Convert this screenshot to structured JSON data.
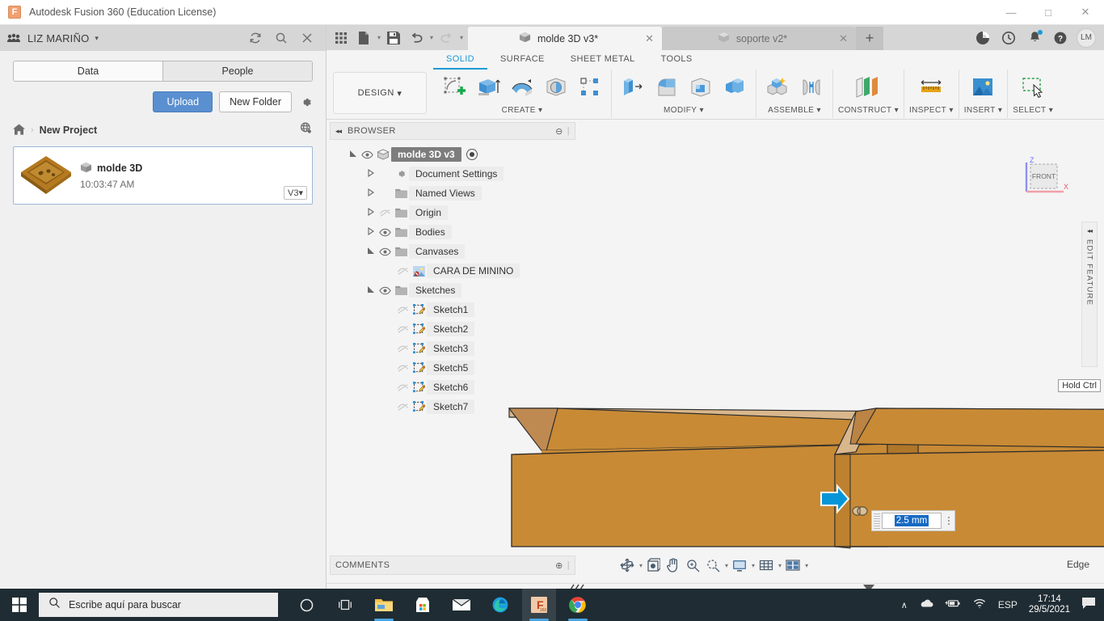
{
  "window": {
    "title": "Autodesk Fusion 360 (Education License)",
    "logo_letter": "F",
    "minimize": "—",
    "maximize": "□",
    "close": "✕"
  },
  "data_panel": {
    "hub_name": "LIZ MARIÑO",
    "hub_caret": "▾",
    "header_icons": [
      "grid-icon",
      "refresh-icon",
      "search-icon",
      "close-icon"
    ],
    "tabs": [
      {
        "label": "Data",
        "active": true
      },
      {
        "label": "People",
        "active": false
      }
    ],
    "upload_label": "Upload",
    "new_folder_label": "New Folder",
    "breadcrumb": {
      "home": "⌂",
      "separator": "›",
      "project": "New Project"
    },
    "file": {
      "name": "molde 3D",
      "time": "10:03:47 AM",
      "version": "V3",
      "version_caret": "▾"
    }
  },
  "quick_access": {
    "icons": [
      "apps-grid-icon",
      "new-file-icon",
      "save-icon",
      "undo-icon",
      "redo-icon"
    ]
  },
  "doc_tabs": [
    {
      "label": "molde 3D v3*",
      "active": true,
      "close": "✕"
    },
    {
      "label": "soporte v2*",
      "active": false,
      "close": "✕"
    }
  ],
  "tab_plus": "+",
  "top_right_icons": [
    "job-status-icon",
    "recent-icon",
    "notifications-icon",
    "help-icon"
  ],
  "avatar_initials": "LM",
  "ribbon": {
    "design_label": "DESIGN",
    "design_caret": "▾",
    "tabs": [
      {
        "label": "SOLID",
        "active": true
      },
      {
        "label": "SURFACE",
        "active": false
      },
      {
        "label": "SHEET METAL",
        "active": false
      },
      {
        "label": "TOOLS",
        "active": false
      }
    ],
    "groups": [
      {
        "label": "CREATE",
        "caret": "▾",
        "icons": [
          "create-sketch-icon",
          "extrude-icon",
          "revolve-icon",
          "sphere-icon",
          "pattern-icon"
        ]
      },
      {
        "label": "MODIFY",
        "caret": "▾",
        "icons": [
          "press-pull-icon",
          "fillet-icon",
          "shell-icon",
          "combine-icon"
        ]
      },
      {
        "label": "ASSEMBLE",
        "caret": "▾",
        "icons": [
          "new-component-icon",
          "joint-icon"
        ]
      },
      {
        "label": "CONSTRUCT",
        "caret": "▾",
        "icons": [
          "offset-plane-icon"
        ]
      },
      {
        "label": "INSPECT",
        "caret": "▾",
        "icons": [
          "measure-icon"
        ]
      },
      {
        "label": "INSERT",
        "caret": "▾",
        "icons": [
          "insert-canvas-icon"
        ]
      },
      {
        "label": "SELECT",
        "caret": "▾",
        "icons": [
          "select-window-icon"
        ]
      }
    ]
  },
  "browser": {
    "title": "BROWSER",
    "collapse": "◂◂",
    "minus": "⊖",
    "tree": [
      {
        "label": "molde 3D v3",
        "indent": 0,
        "arrow": "open",
        "eye": "on",
        "icon": "component-icon",
        "root": true
      },
      {
        "label": "Document Settings",
        "indent": 1,
        "arrow": "closed",
        "eye": "none",
        "icon": "gear-icon"
      },
      {
        "label": "Named Views",
        "indent": 1,
        "arrow": "closed",
        "eye": "none",
        "icon": "folder-icon"
      },
      {
        "label": "Origin",
        "indent": 1,
        "arrow": "closed",
        "eye": "off",
        "icon": "folder-icon"
      },
      {
        "label": "Bodies",
        "indent": 1,
        "arrow": "closed",
        "eye": "on",
        "icon": "folder-icon"
      },
      {
        "label": "Canvases",
        "indent": 1,
        "arrow": "open",
        "eye": "on",
        "icon": "folder-icon"
      },
      {
        "label": "CARA DE MININO",
        "indent": 2,
        "arrow": "none",
        "eye": "off",
        "icon": "canvas-icon"
      },
      {
        "label": "Sketches",
        "indent": 1,
        "arrow": "open",
        "eye": "on",
        "icon": "folder-icon"
      },
      {
        "label": "Sketch1",
        "indent": 2,
        "arrow": "none",
        "eye": "off",
        "icon": "sketch-icon"
      },
      {
        "label": "Sketch2",
        "indent": 2,
        "arrow": "none",
        "eye": "off",
        "icon": "sketch-icon"
      },
      {
        "label": "Sketch3",
        "indent": 2,
        "arrow": "none",
        "eye": "off",
        "icon": "sketch-icon"
      },
      {
        "label": "Sketch5",
        "indent": 2,
        "arrow": "none",
        "eye": "off",
        "icon": "sketch-icon"
      },
      {
        "label": "Sketch6",
        "indent": 2,
        "arrow": "none",
        "eye": "off",
        "icon": "sketch-icon"
      },
      {
        "label": "Sketch7",
        "indent": 2,
        "arrow": "none",
        "eye": "off",
        "icon": "sketch-icon"
      }
    ]
  },
  "viewport": {
    "viewcube_face": "FRONT",
    "axis_z": "Z",
    "axis_x": "X",
    "edit_feature_label": "EDIT FEATURE",
    "edit_feature_collapse": "◂◂",
    "hold_ctrl_tooltip": "Hold Ctrl",
    "dimension_value": "2.5 mm",
    "model_color": "#c88a35",
    "model_color_light": "#d9b78c",
    "model_color_dark": "#b0762a",
    "manipulator_arrow_color": "#0696d7",
    "selection_highlight": "#1669c4"
  },
  "comments": {
    "title": "COMMENTS",
    "add": "⊕"
  },
  "nav_toolbar": {
    "icons": [
      "orbit-icon",
      "view-front-icon",
      "pan-icon",
      "zoom-icon",
      "fit-icon",
      "display-settings-icon",
      "grid-snaps-icon",
      "viewports-icon"
    ]
  },
  "status": {
    "selection_filter": "Edge"
  },
  "timeline": {
    "playback": [
      "skip-start-icon",
      "step-back-icon",
      "play-icon",
      "step-forward-icon",
      "skip-end-icon"
    ],
    "nodes": [
      "sketch-icon",
      "extrude-icon",
      "sketch-icon",
      "canvas-icon",
      "extrude-icon",
      "sketch-icon",
      "extrude-icon",
      "sketch-icon",
      "extrude-icon",
      "sketch-icon",
      "extrude-icon",
      "sketch-icon",
      "extrude-icon",
      "fillet-icon",
      "fillet-icon",
      "fillet-icon",
      "fillet-icon",
      "fillet-icon",
      "fillet-icon",
      "fillet-icon",
      "fillet-icon"
    ],
    "settings": "gear-icon"
  },
  "taskbar": {
    "start": "windows-icon",
    "search_placeholder": "Escribe aquí para buscar",
    "apps": [
      {
        "name": "cortana-icon",
        "active": false,
        "running": false
      },
      {
        "name": "task-view-icon",
        "active": false,
        "running": false
      },
      {
        "name": "file-explorer-icon",
        "active": false,
        "running": true
      },
      {
        "name": "microsoft-store-icon",
        "active": false,
        "running": false
      },
      {
        "name": "mail-icon",
        "active": false,
        "running": false
      },
      {
        "name": "edge-icon",
        "active": false,
        "running": false
      },
      {
        "name": "fusion360-icon",
        "active": true,
        "running": true
      },
      {
        "name": "chrome-icon",
        "active": false,
        "running": true
      }
    ],
    "tray": {
      "chevron": "∧",
      "icons": [
        "onedrive-icon",
        "battery-icon",
        "wifi-icon"
      ],
      "language": "ESP",
      "time": "17:14",
      "date": "29/5/2021",
      "action_center": "notifications-icon"
    }
  }
}
